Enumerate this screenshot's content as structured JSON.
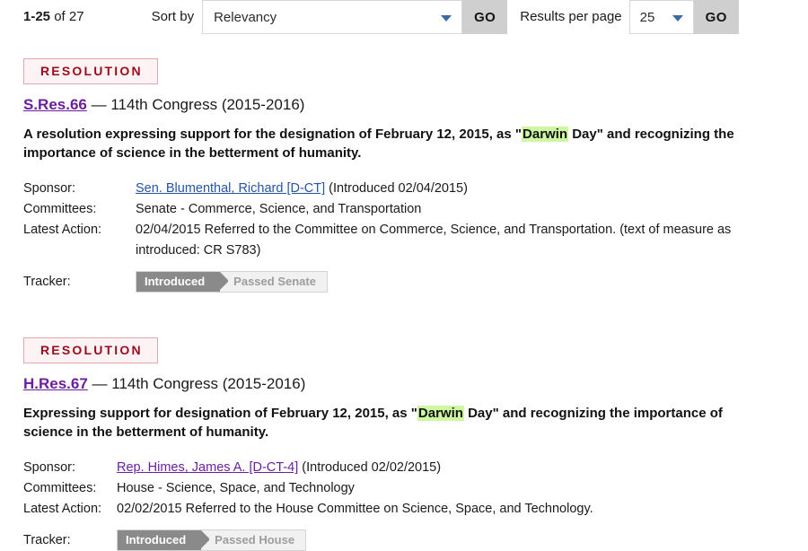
{
  "toolbar": {
    "result_count": {
      "range": "1-25",
      "rest": " of 27"
    },
    "sort": {
      "label": "Sort by",
      "selected": "Relevancy",
      "go_label": "GO",
      "caret_icon": "chevron-down-icon"
    },
    "results_per_page": {
      "label": "Results per page",
      "selected": "25",
      "go_label": "GO",
      "caret_icon": "chevron-down-icon"
    }
  },
  "colors": {
    "badge_text": "#9c0b1c",
    "badge_border": "#e2a8b0",
    "badge_background": "#fdf2f4",
    "visited_link": "#6b1f9e",
    "unvisited_link": "#2554a8",
    "highlight": "#cdf7a0",
    "tracker_done": "#8a8a8a",
    "tracker_pending": "#f1f1f1",
    "go_button": "#cfcfcf",
    "caret": "#3d6ba5"
  },
  "results": [
    {
      "badge": "RESOLUTION",
      "bill_number": "S.Res.66",
      "congress": " — 114th Congress (2015-2016)",
      "title_parts": [
        {
          "text": "A resolution expressing support for the designation of February 12, 2015, as \"",
          "highlight": false
        },
        {
          "text": "Darwin",
          "highlight": true
        },
        {
          "text": " Day\" and recognizing the importance of science in the betterment of humanity.",
          "highlight": false
        }
      ],
      "meta": {
        "sponsor_label": "Sponsor:",
        "sponsor_link": "Sen. Blumenthal, Richard [D-CT]",
        "sponsor_link_state": "unvisited",
        "sponsor_suffix": " (Introduced 02/04/2015)",
        "committees_label": "Committees:",
        "committees_value": "Senate - Commerce, Science, and Transportation",
        "latest_action_label": "Latest Action:",
        "latest_action_value": "02/04/2015 Referred to the Committee on Commerce, Science, and Transportation. (text of measure as introduced: CR S783)",
        "tracker_label": "Tracker:"
      },
      "tracker": {
        "done_step": "Introduced",
        "pending_step": "Passed Senate"
      }
    },
    {
      "badge": "RESOLUTION",
      "bill_number": "H.Res.67",
      "congress": " — 114th Congress (2015-2016)",
      "title_parts": [
        {
          "text": "Expressing support for designation of February 12, 2015, as \"",
          "highlight": false
        },
        {
          "text": "Darwin",
          "highlight": true
        },
        {
          "text": " Day\" and recognizing the importance of science in the betterment of humanity.",
          "highlight": false
        }
      ],
      "meta": {
        "sponsor_label": "Sponsor:",
        "sponsor_link": "Rep. Himes, James A. [D-CT-4]",
        "sponsor_link_state": "visited",
        "sponsor_suffix": " (Introduced 02/02/2015)",
        "committees_label": "Committees:",
        "committees_value": "House - Science, Space, and Technology",
        "latest_action_label": "Latest Action:",
        "latest_action_value": "02/02/2015 Referred to the House Committee on Science, Space, and Technology.",
        "tracker_label": "Tracker:"
      },
      "tracker": {
        "done_step": "Introduced",
        "pending_step": "Passed House"
      }
    }
  ]
}
